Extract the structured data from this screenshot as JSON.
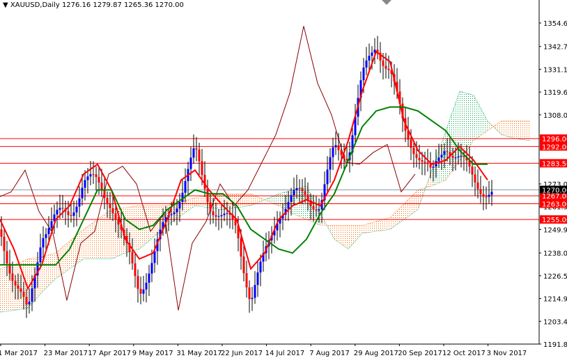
{
  "title": {
    "symbol": "XAUUSD,Daily",
    "ohlc": "1276.16 1279.87 1265.36 1270.00"
  },
  "chart_data": {
    "type": "candlestick",
    "title": "XAUUSD,Daily",
    "ylim": [
      1191.85,
      1354.6
    ],
    "y_ticks": [
      "1354.60",
      "1342.70",
      "1331.15",
      "1319.60",
      "1308.05",
      "1273.05",
      "1261.50",
      "1249.95",
      "1238.05",
      "1226.50",
      "1214.95",
      "1203.40",
      "1191.85"
    ],
    "x_ticks": [
      "1 Mar 2017",
      "23 Mar 2017",
      "17 Apr 2017",
      "9 May 2017",
      "31 May 2017",
      "22 Jun 2017",
      "14 Jul 2017",
      "7 Aug 2017",
      "29 Aug 2017",
      "20 Sep 2017",
      "12 Oct 2017",
      "3 Nov 2017"
    ],
    "close_samples": [
      1250,
      1225,
      1205,
      1250,
      1255,
      1258,
      1275,
      1272,
      1265,
      1240,
      1220,
      1235,
      1255,
      1270,
      1288,
      1265,
      1255,
      1250,
      1215,
      1235,
      1260,
      1265,
      1268,
      1262,
      1290,
      1290,
      1325,
      1345,
      1330,
      1300,
      1290,
      1275,
      1295,
      1285,
      1275,
      1270
    ],
    "tenkan": [
      1255,
      1240,
      1220,
      1232,
      1255,
      1262,
      1278,
      1283,
      1270,
      1245,
      1235,
      1238,
      1255,
      1275,
      1280,
      1270,
      1262,
      1255,
      1230,
      1238,
      1255,
      1262,
      1265,
      1262,
      1275,
      1295,
      1320,
      1340,
      1335,
      1305,
      1290,
      1283,
      1285,
      1292,
      1285,
      1275
    ],
    "kijun": [
      1232,
      1232,
      1232,
      1232,
      1232,
      1240,
      1255,
      1270,
      1270,
      1255,
      1250,
      1252,
      1260,
      1265,
      1270,
      1268,
      1268,
      1262,
      1250,
      1245,
      1240,
      1238,
      1245,
      1258,
      1268,
      1285,
      1302,
      1310,
      1312,
      1312,
      1310,
      1305,
      1300,
      1290,
      1283,
      1283
    ],
    "span_a": [
      1208,
      1209,
      1210,
      1218,
      1225,
      1230,
      1235,
      1235,
      1235,
      1238,
      1240,
      1246,
      1252,
      1257,
      1262,
      1261,
      1260,
      1261,
      1262,
      1265,
      1268,
      1270,
      1272,
      1258,
      1245,
      1240,
      1248,
      1249,
      1250,
      1255,
      1260,
      1280,
      1300,
      1320,
      1318,
      1305,
      1298,
      1296,
      1295
    ],
    "span_b": [
      1230,
      1232,
      1235,
      1236,
      1238,
      1244,
      1250,
      1255,
      1260,
      1261,
      1262,
      1262,
      1262,
      1264,
      1266,
      1267,
      1268,
      1268,
      1268,
      1265,
      1262,
      1258,
      1255,
      1252,
      1252,
      1252,
      1252,
      1254,
      1256,
      1263,
      1270,
      1272,
      1275,
      1285,
      1295,
      1300,
      1305,
      1305,
      1305
    ],
    "levels": [
      {
        "price": "1296.00",
        "value": 1296
      },
      {
        "price": "1292.00",
        "value": 1292
      },
      {
        "price": "1283.50",
        "value": 1283.5
      },
      {
        "price": "1267.00",
        "value": 1267
      },
      {
        "price": "1263.00",
        "value": 1263
      },
      {
        "price": "1255.00",
        "value": 1255
      }
    ],
    "current_price": {
      "label": "1270.00",
      "value": 1270
    },
    "colors": {
      "bull": "#0000ff",
      "bear": "#ff0000",
      "tenkan": "#ff0000",
      "kijun": "#008000",
      "chikou": "#8b0000",
      "cloud_up": "#00a550",
      "cloud_down": "#ff6600",
      "level": "#ff0000"
    }
  }
}
